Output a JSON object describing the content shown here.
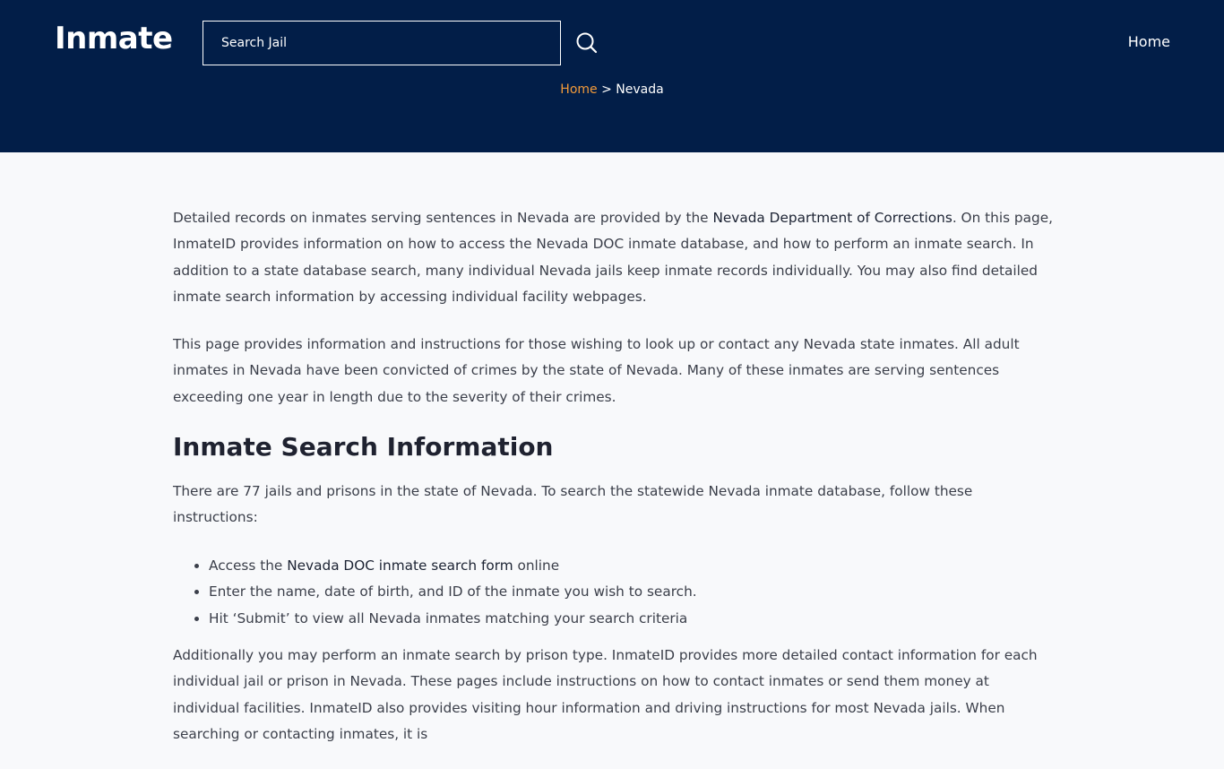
{
  "header": {
    "logo": "Inmate",
    "search_placeholder": "Search Jail",
    "nav_home": "Home"
  },
  "breadcrumb": {
    "home": "Home",
    "separator": " > ",
    "current": "Nevada"
  },
  "content": {
    "p1": {
      "before": "Detailed records on inmates serving sentences in Nevada are provided by the ",
      "link": "Nevada Department of Corrections",
      "after": ". On this page, InmateID provides information on how to access the Nevada DOC inmate database, and how to perform an inmate search. In addition to a state database search, many individual Nevada jails keep inmate records individually. You may also find detailed inmate search information by accessing individual facility webpages."
    },
    "p2": "This page provides information and instructions for those wishing to look up or contact any Nevada state inmates. All adult inmates in Nevada have been convicted of crimes by the state of Nevada. Many of these inmates are serving sentences exceeding one year in length due to the severity of their crimes.",
    "h2": "Inmate Search Information",
    "p3": "There are 77 jails and prisons in the state of Nevada. To search the statewide Nevada inmate database, follow these instructions:",
    "list": {
      "item1_before": "Access the ",
      "item1_link": "Nevada DOC inmate search form",
      "item1_after": " online",
      "item2": "Enter the name, date of birth, and ID of the inmate you wish to search.",
      "item3": "Hit ‘Submit’ to view all Nevada inmates matching your search criteria"
    },
    "p4": "Additionally you may perform an inmate search by prison type. InmateID provides more detailed contact information for each individual jail or prison in Nevada. These pages include instructions on how to contact inmates or send them money at individual facilities. InmateID also provides visiting hour information and driving instructions for most Nevada jails. When searching or contacting inmates, it is"
  },
  "colors": {
    "header_bg": "#021e48",
    "breadcrumb_link": "#f29a3a",
    "page_bg": "#f8f9fb"
  },
  "icons": {
    "search": "search-icon"
  }
}
